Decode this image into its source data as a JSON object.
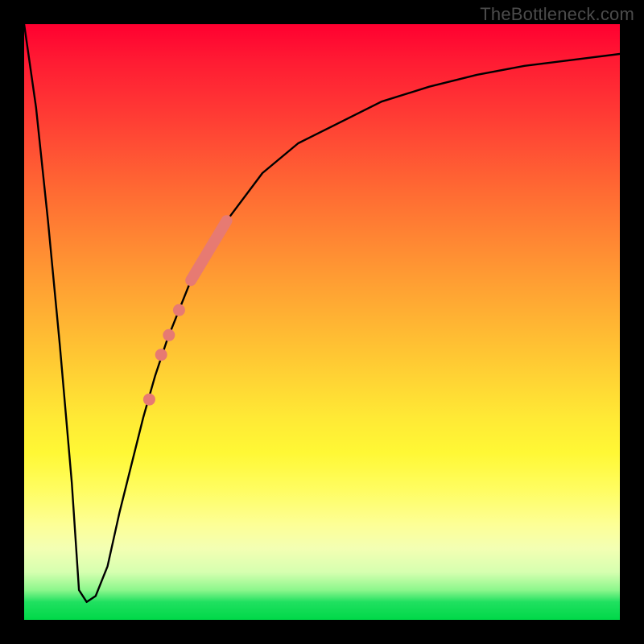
{
  "watermark": "TheBottleneck.com",
  "chart_data": {
    "type": "line",
    "title": "",
    "xlabel": "",
    "ylabel": "",
    "xlim": [
      0,
      100
    ],
    "ylim": [
      0,
      100
    ],
    "grid": false,
    "series": [
      {
        "name": "bottleneck-curve",
        "x": [
          0,
          2,
          4,
          6,
          8,
          9.2,
          10.5,
          12,
          14,
          16,
          18,
          20,
          22,
          24,
          26,
          28,
          30,
          34,
          40,
          46,
          52,
          60,
          68,
          76,
          84,
          92,
          100
        ],
        "values": [
          100,
          86,
          67,
          46,
          23,
          5,
          3,
          4,
          9,
          18,
          26,
          34,
          41,
          47,
          52,
          57,
          61,
          67,
          75,
          80,
          83,
          87,
          89.5,
          91.5,
          93,
          94,
          95
        ]
      }
    ],
    "markers": [
      {
        "name": "highlight-segment",
        "type": "segment",
        "x1": 28,
        "y1": 57,
        "x2": 34,
        "y2": 67
      },
      {
        "name": "dot-a",
        "type": "dot",
        "x": 26,
        "y": 52
      },
      {
        "name": "dot-b",
        "type": "dot",
        "x": 24.3,
        "y": 47.8
      },
      {
        "name": "dot-c",
        "type": "dot",
        "x": 23,
        "y": 44.5
      },
      {
        "name": "dot-d",
        "type": "dot",
        "x": 21,
        "y": 37
      }
    ],
    "gradient_stops": [
      {
        "pos": 0,
        "color": "#ff0030"
      },
      {
        "pos": 15,
        "color": "#ff3a34"
      },
      {
        "pos": 42,
        "color": "#ff9a33"
      },
      {
        "pos": 66,
        "color": "#ffe935"
      },
      {
        "pos": 88,
        "color": "#f3ffb3"
      },
      {
        "pos": 100,
        "color": "#00d848"
      }
    ]
  }
}
